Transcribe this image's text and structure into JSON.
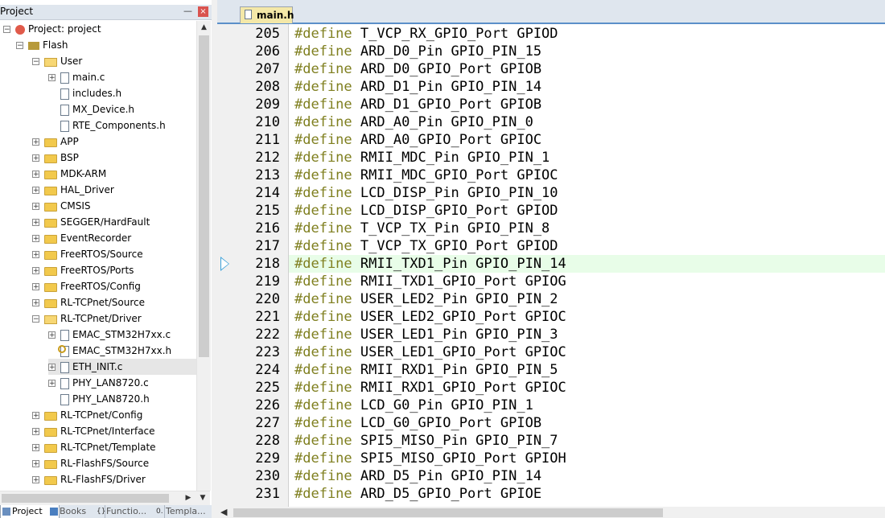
{
  "project_panel": {
    "title": "Project",
    "pin_glyph": "—",
    "close_glyph": "×",
    "tree": [
      {
        "label": "Project: project",
        "depth": 0,
        "expander": "−",
        "icon": "project-icon"
      },
      {
        "label": "Flash",
        "depth": 1,
        "expander": "−",
        "icon": "flash-icon"
      },
      {
        "label": "User",
        "depth": 2,
        "expander": "−",
        "icon": "folder-open-icon"
      },
      {
        "label": "main.c",
        "depth": 3,
        "expander": "+",
        "icon": "file-icon"
      },
      {
        "label": "includes.h",
        "depth": 3,
        "expander": "",
        "icon": "file-icon"
      },
      {
        "label": "MX_Device.h",
        "depth": 3,
        "expander": "",
        "icon": "file-icon"
      },
      {
        "label": "RTE_Components.h",
        "depth": 3,
        "expander": "",
        "icon": "file-icon"
      },
      {
        "label": "APP",
        "depth": 2,
        "expander": "+",
        "icon": "folder-icon"
      },
      {
        "label": "BSP",
        "depth": 2,
        "expander": "+",
        "icon": "folder-icon"
      },
      {
        "label": "MDK-ARM",
        "depth": 2,
        "expander": "+",
        "icon": "folder-icon"
      },
      {
        "label": "HAL_Driver",
        "depth": 2,
        "expander": "+",
        "icon": "folder-icon"
      },
      {
        "label": "CMSIS",
        "depth": 2,
        "expander": "+",
        "icon": "folder-icon"
      },
      {
        "label": "SEGGER/HardFault",
        "depth": 2,
        "expander": "+",
        "icon": "folder-icon"
      },
      {
        "label": "EventRecorder",
        "depth": 2,
        "expander": "+",
        "icon": "folder-icon"
      },
      {
        "label": "FreeRTOS/Source",
        "depth": 2,
        "expander": "+",
        "icon": "folder-icon"
      },
      {
        "label": "FreeRTOS/Ports",
        "depth": 2,
        "expander": "+",
        "icon": "folder-icon"
      },
      {
        "label": "FreeRTOS/Config",
        "depth": 2,
        "expander": "+",
        "icon": "folder-icon"
      },
      {
        "label": "RL-TCPnet/Source",
        "depth": 2,
        "expander": "+",
        "icon": "folder-icon"
      },
      {
        "label": "RL-TCPnet/Driver",
        "depth": 2,
        "expander": "−",
        "icon": "folder-open-icon"
      },
      {
        "label": "EMAC_STM32H7xx.c",
        "depth": 3,
        "expander": "+",
        "icon": "file-icon"
      },
      {
        "label": "EMAC_STM32H7xx.h",
        "depth": 3,
        "expander": "",
        "icon": "key-file-icon"
      },
      {
        "label": "ETH_INIT.c",
        "depth": 3,
        "expander": "+",
        "icon": "file-icon",
        "selected": true
      },
      {
        "label": "PHY_LAN8720.c",
        "depth": 3,
        "expander": "+",
        "icon": "file-icon"
      },
      {
        "label": "PHY_LAN8720.h",
        "depth": 3,
        "expander": "",
        "icon": "file-icon"
      },
      {
        "label": "RL-TCPnet/Config",
        "depth": 2,
        "expander": "+",
        "icon": "folder-icon"
      },
      {
        "label": "RL-TCPnet/Interface",
        "depth": 2,
        "expander": "+",
        "icon": "folder-icon"
      },
      {
        "label": "RL-TCPnet/Template",
        "depth": 2,
        "expander": "+",
        "icon": "folder-icon"
      },
      {
        "label": "RL-FlashFS/Source",
        "depth": 2,
        "expander": "+",
        "icon": "folder-icon"
      },
      {
        "label": "RL-FlashFS/Driver",
        "depth": 2,
        "expander": "+",
        "icon": "folder-icon"
      }
    ],
    "scroll_up_glyph": "▲",
    "scroll_right_glyph": "▶",
    "scroll_down_glyph": "▼",
    "bottom_tabs": [
      {
        "label": "Project",
        "icon": "project-tab-icon",
        "active": true
      },
      {
        "label": "Books",
        "icon": "books-icon",
        "active": false
      },
      {
        "label": "Functio...",
        "icon": "functions-icon",
        "active": false
      },
      {
        "label": "Templa...",
        "icon": "templates-icon",
        "active": false
      }
    ]
  },
  "editor": {
    "tab_label": "main.h",
    "current_line": "218",
    "scroll_left_glyph": "◀",
    "keyword": "#define",
    "lines": [
      {
        "num": "205",
        "kw": "#define",
        "rest": " T_VCP_RX_GPIO_Port GPIOD"
      },
      {
        "num": "206",
        "kw": "#define",
        "rest": " ARD_D0_Pin GPIO_PIN_15"
      },
      {
        "num": "207",
        "kw": "#define",
        "rest": " ARD_D0_GPIO_Port GPIOB"
      },
      {
        "num": "208",
        "kw": "#define",
        "rest": " ARD_D1_Pin GPIO_PIN_14"
      },
      {
        "num": "209",
        "kw": "#define",
        "rest": " ARD_D1_GPIO_Port GPIOB"
      },
      {
        "num": "210",
        "kw": "#define",
        "rest": " ARD_A0_Pin GPIO_PIN_0"
      },
      {
        "num": "211",
        "kw": "#define",
        "rest": " ARD_A0_GPIO_Port GPIOC"
      },
      {
        "num": "212",
        "kw": "#define",
        "rest": " RMII_MDC_Pin GPIO_PIN_1"
      },
      {
        "num": "213",
        "kw": "#define",
        "rest": " RMII_MDC_GPIO_Port GPIOC"
      },
      {
        "num": "214",
        "kw": "#define",
        "rest": " LCD_DISP_Pin GPIO_PIN_10"
      },
      {
        "num": "215",
        "kw": "#define",
        "rest": " LCD_DISP_GPIO_Port GPIOD"
      },
      {
        "num": "216",
        "kw": "#define",
        "rest": " T_VCP_TX_Pin GPIO_PIN_8"
      },
      {
        "num": "217",
        "kw": "#define",
        "rest": " T_VCP_TX_GPIO_Port GPIOD"
      },
      {
        "num": "218",
        "kw": "#define",
        "rest": " RMII_TXD1_Pin GPIO_PIN_14"
      },
      {
        "num": "219",
        "kw": "#define",
        "rest": " RMII_TXD1_GPIO_Port GPIOG"
      },
      {
        "num": "220",
        "kw": "#define",
        "rest": " USER_LED2_Pin GPIO_PIN_2"
      },
      {
        "num": "221",
        "kw": "#define",
        "rest": " USER_LED2_GPIO_Port GPIOC"
      },
      {
        "num": "222",
        "kw": "#define",
        "rest": " USER_LED1_Pin GPIO_PIN_3"
      },
      {
        "num": "223",
        "kw": "#define",
        "rest": " USER_LED1_GPIO_Port GPIOC"
      },
      {
        "num": "224",
        "kw": "#define",
        "rest": " RMII_RXD1_Pin GPIO_PIN_5"
      },
      {
        "num": "225",
        "kw": "#define",
        "rest": " RMII_RXD1_GPIO_Port GPIOC"
      },
      {
        "num": "226",
        "kw": "#define",
        "rest": " LCD_G0_Pin GPIO_PIN_1"
      },
      {
        "num": "227",
        "kw": "#define",
        "rest": " LCD_G0_GPIO_Port GPIOB"
      },
      {
        "num": "228",
        "kw": "#define",
        "rest": " SPI5_MISO_Pin GPIO_PIN_7"
      },
      {
        "num": "229",
        "kw": "#define",
        "rest": " SPI5_MISO_GPIO_Port GPIOH"
      },
      {
        "num": "230",
        "kw": "#define",
        "rest": " ARD_D5_Pin GPIO_PIN_14"
      },
      {
        "num": "231",
        "kw": "#define",
        "rest": " ARD_D5_GPIO_Port GPIOE"
      }
    ]
  },
  "colors": {
    "keyword": "#7f7f1f",
    "current_line_bg": "#e8fde8",
    "tab_bg": "#f4e8a8",
    "panel_header_bg": "#dfe6ee",
    "gutter_bg": "#f0f0f0"
  }
}
